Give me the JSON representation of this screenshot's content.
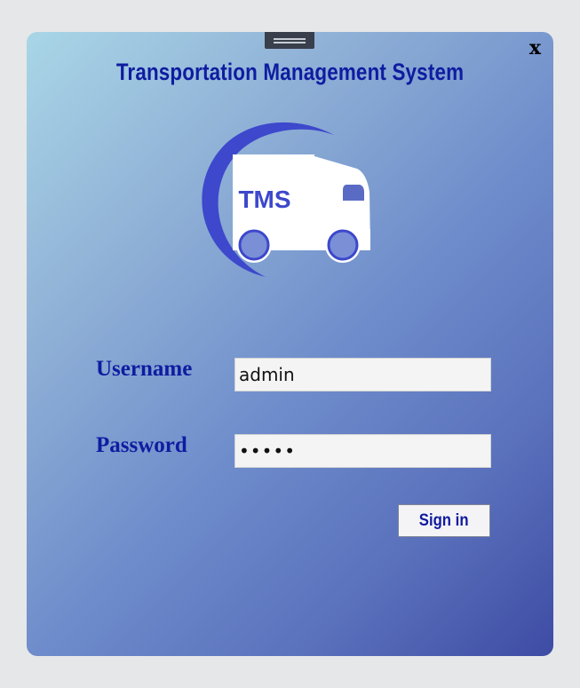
{
  "window": {
    "title": "Transportation Management System",
    "close_label": "x"
  },
  "logo": {
    "text": "TMS",
    "icon": "truck-icon",
    "color": "#3d48cc"
  },
  "form": {
    "username_label": "Username",
    "username_value": "admin",
    "password_label": "Password",
    "password_value": "•••••",
    "signin_label": "Sign in"
  },
  "colors": {
    "accent": "#0f1ca0",
    "gradient_start": "#a9d6e7",
    "gradient_end": "#3e4ca4"
  }
}
